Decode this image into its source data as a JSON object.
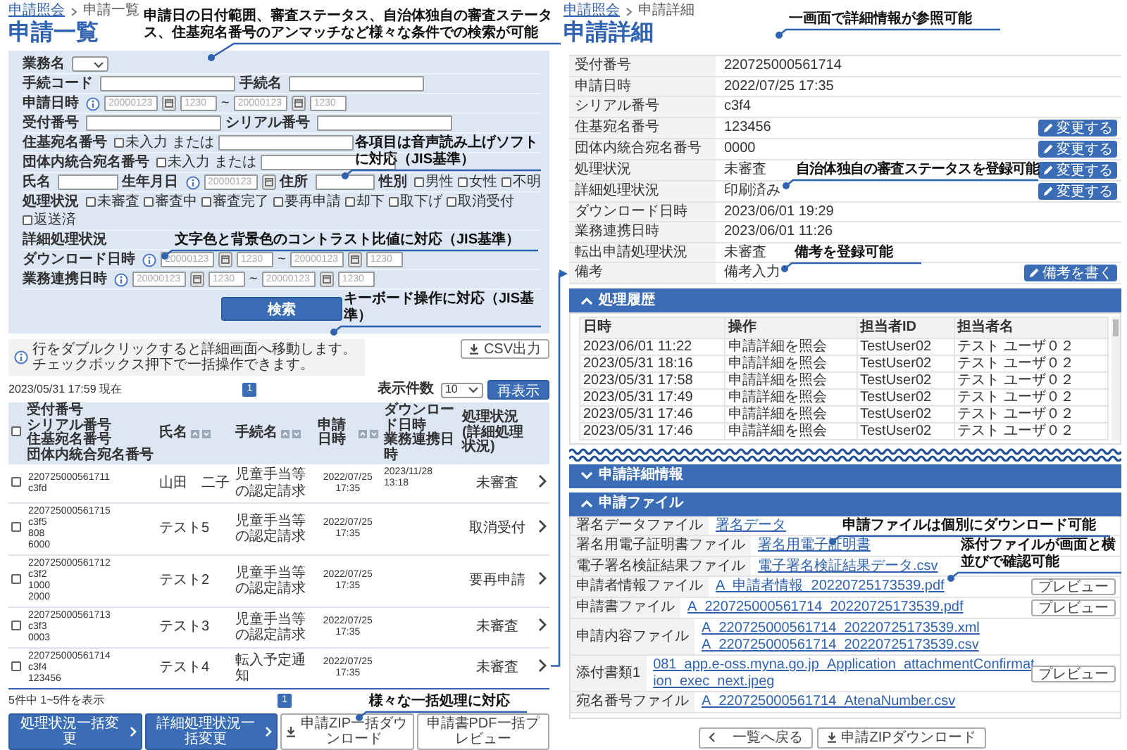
{
  "list_page": {
    "breadcrumb": [
      {
        "label": "申請照会",
        "link": true
      },
      {
        "label": "申請一覧",
        "link": false
      }
    ],
    "title": "申請一覧",
    "search_form": {
      "rows": [
        {
          "items": [
            {
              "kind": "label",
              "text": "業務名"
            },
            {
              "kind": "select"
            }
          ]
        },
        {
          "items": [
            {
              "kind": "label",
              "text": "手続コード"
            },
            {
              "kind": "input"
            },
            {
              "kind": "label",
              "text": "手続名"
            },
            {
              "kind": "input"
            }
          ]
        },
        {
          "items": [
            {
              "kind": "label",
              "text": "申請日時"
            },
            {
              "kind": "info"
            },
            {
              "kind": "date",
              "placeholder": "20000123"
            },
            {
              "kind": "calendar"
            },
            {
              "kind": "time",
              "placeholder": "1230"
            },
            {
              "kind": "text",
              "text": "~"
            },
            {
              "kind": "date",
              "placeholder": "20000123"
            },
            {
              "kind": "calendar"
            },
            {
              "kind": "time",
              "placeholder": "1230"
            }
          ]
        },
        {
          "items": [
            {
              "kind": "label",
              "text": "受付番号"
            },
            {
              "kind": "input"
            },
            {
              "kind": "label",
              "text": "シリアル番号"
            },
            {
              "kind": "input"
            }
          ]
        },
        {
          "items": [
            {
              "kind": "label",
              "text": "住基宛名番号"
            },
            {
              "kind": "checkbox",
              "label": "未入力",
              "checked": false
            },
            {
              "kind": "text",
              "text": "または"
            },
            {
              "kind": "input"
            }
          ]
        },
        {
          "items": [
            {
              "kind": "label",
              "text": "団体内統合宛名番号"
            },
            {
              "kind": "checkbox",
              "label": "未入力",
              "checked": false
            },
            {
              "kind": "text",
              "text": "または"
            },
            {
              "kind": "input"
            }
          ]
        },
        {
          "items": [
            {
              "kind": "label",
              "text": "氏名"
            },
            {
              "kind": "input"
            },
            {
              "kind": "label",
              "text": "生年月日"
            },
            {
              "kind": "info"
            },
            {
              "kind": "date",
              "placeholder": "20000123"
            },
            {
              "kind": "calendar"
            },
            {
              "kind": "label",
              "text": "住所"
            },
            {
              "kind": "input"
            },
            {
              "kind": "label",
              "text": "性別"
            },
            {
              "kind": "checkbox",
              "label": "男性",
              "checked": false
            },
            {
              "kind": "checkbox",
              "label": "女性",
              "checked": false
            },
            {
              "kind": "checkbox",
              "label": "不明",
              "checked": false
            }
          ]
        },
        {
          "items": [
            {
              "kind": "label",
              "text": "処理状況"
            },
            {
              "kind": "checkbox",
              "label": "未審査",
              "checked": false
            },
            {
              "kind": "checkbox",
              "label": "審査中",
              "checked": false
            },
            {
              "kind": "checkbox",
              "label": "審査完了",
              "checked": false
            },
            {
              "kind": "checkbox",
              "label": "要再申請",
              "checked": false
            },
            {
              "kind": "checkbox",
              "label": "却下",
              "checked": false
            },
            {
              "kind": "checkbox",
              "label": "取下げ",
              "checked": false
            },
            {
              "kind": "checkbox",
              "label": "取消受付",
              "checked": false
            },
            {
              "kind": "checkbox",
              "label": "返送済",
              "checked": false
            }
          ]
        },
        {
          "items": [
            {
              "kind": "label",
              "text": "詳細処理状況"
            }
          ]
        },
        {
          "items": [
            {
              "kind": "label",
              "text": "ダウンロード日時"
            },
            {
              "kind": "info"
            },
            {
              "kind": "date",
              "placeholder": "20000123"
            },
            {
              "kind": "calendar"
            },
            {
              "kind": "time",
              "placeholder": "1230"
            },
            {
              "kind": "text",
              "text": "~"
            },
            {
              "kind": "date",
              "placeholder": "20000123"
            },
            {
              "kind": "calendar"
            },
            {
              "kind": "time",
              "placeholder": "1230"
            }
          ]
        },
        {
          "items": [
            {
              "kind": "label",
              "text": "業務連携日時"
            },
            {
              "kind": "info"
            },
            {
              "kind": "date",
              "placeholder": "20000123"
            },
            {
              "kind": "calendar"
            },
            {
              "kind": "time",
              "placeholder": "1230"
            },
            {
              "kind": "text",
              "text": "~"
            },
            {
              "kind": "date",
              "placeholder": "20000123"
            },
            {
              "kind": "calendar"
            },
            {
              "kind": "time",
              "placeholder": "1230"
            }
          ]
        }
      ],
      "submit": "検索"
    },
    "csv_button": "CSV出力",
    "notice": [
      "行をダブルクリックすると詳細画面へ移動します。",
      "チェックボックス押下で一括操作できます。"
    ],
    "as_of": "2023/05/31 17:59 現在",
    "pages": [
      {
        "label": "1",
        "selected": true
      }
    ],
    "page_size_label": "表示件数",
    "page_size": "10",
    "refresh_button": "再表示",
    "table": {
      "columns": [
        {
          "kind": "checkbox",
          "checked": false
        },
        {
          "kind": "text",
          "lines": [
            "受付番号",
            "シリアル番号",
            "住基宛名番号",
            "団体内統合宛名番号"
          ],
          "sortable": false
        },
        {
          "kind": "text",
          "lines": [
            "氏名"
          ],
          "sortable": true
        },
        {
          "kind": "text",
          "lines": [
            "手続名"
          ],
          "sortable": true
        },
        {
          "kind": "text",
          "lines": [
            "申請日時"
          ],
          "sortable": true
        },
        {
          "kind": "text",
          "lines": [
            "ダウンロード日時",
            "業務連携日時"
          ],
          "sortable": false
        },
        {
          "kind": "text",
          "lines": [
            "処理状況",
            "(詳細処理状況)"
          ],
          "sortable": false
        }
      ],
      "rows": [
        {
          "checked": false,
          "ids": [
            "220725000561711",
            "c3fd"
          ],
          "name": "山田　二子",
          "procedure": "児童手当等の認定請求",
          "applied": [
            "2022/07/25",
            "17:35"
          ],
          "downloaded": "2023/11/28 13:18",
          "status": "未審査"
        },
        {
          "checked": false,
          "ids": [
            "220725000561715",
            "c3f5",
            "808",
            "6000"
          ],
          "name": "テスト5",
          "procedure": "児童手当等の認定請求",
          "applied": [
            "2022/07/25",
            "17:35"
          ],
          "status": "取消受付"
        },
        {
          "checked": false,
          "ids": [
            "220725000561712",
            "c3f2",
            "1000",
            "2000"
          ],
          "name": "テスト2",
          "procedure": "児童手当等の認定請求",
          "applied": [
            "2022/07/25",
            "17:35"
          ],
          "status": "要再申請"
        },
        {
          "checked": false,
          "ids": [
            "220725000561713",
            "c3f3",
            "0003"
          ],
          "name": "テスト3",
          "procedure": "児童手当等の認定請求",
          "applied": [
            "2022/07/25",
            "17:35"
          ],
          "status": "未審査"
        },
        {
          "checked": false,
          "ids": [
            "220725000561714",
            "c3f4",
            "123456"
          ],
          "name": "テスト4",
          "procedure": "転入予定通知",
          "applied": [
            "2022/07/25",
            "17:35"
          ],
          "status": "未審査"
        }
      ]
    },
    "summary": "5件中 1~5件を表示",
    "footer_pages": [
      {
        "label": "1",
        "selected": true
      }
    ],
    "actions": [
      {
        "label": "処理状況一括変更",
        "kind": "primary"
      },
      {
        "label": "詳細処理状況一括変更",
        "kind": "primary"
      },
      {
        "label": "申請ZIP一括ダウンロード",
        "kind": "download"
      },
      {
        "label": "申請書PDF一括プレビュー",
        "kind": "plain"
      }
    ]
  },
  "detail_page": {
    "breadcrumb": [
      {
        "label": "申請照会",
        "link": true
      },
      {
        "label": "申請詳細",
        "link": false
      }
    ],
    "title": "申請詳細",
    "fields": [
      {
        "label": "受付番号",
        "value": "220725000561714"
      },
      {
        "label": "申請日時",
        "value": "2022/07/25 17:35"
      },
      {
        "label": "シリアル番号",
        "value": "c3f4"
      },
      {
        "label": "住基宛名番号",
        "value": "123456",
        "action": "変更する"
      },
      {
        "label": "団体内統合宛名番号",
        "value": "0000",
        "action": "変更する"
      },
      {
        "label": "処理状況",
        "value": "未審査",
        "action": "変更する"
      },
      {
        "label": "詳細処理状況",
        "value": "印刷済み",
        "action": "変更する"
      },
      {
        "label": "ダウンロード日時",
        "value": "2023/06/01 19:29"
      },
      {
        "label": "業務連携日時",
        "value": "2023/06/01 11:26"
      },
      {
        "label": "転出申請処理状況",
        "value": "未審査"
      },
      {
        "label": "備考",
        "value": "備考入力",
        "action": "備考を書く"
      }
    ],
    "sections": [
      {
        "kind": "history",
        "title": "処理履歴",
        "expanded": true,
        "cut_below": true,
        "columns": [
          "日時",
          "操作",
          "担当者ID",
          "担当者名"
        ],
        "rows": [
          [
            "2023/06/01 11:22",
            "申請詳細を照会",
            "TestUser02",
            "テスト ユーザ０２"
          ],
          [
            "2023/05/31 18:16",
            "申請詳細を照会",
            "TestUser02",
            "テスト ユーザ０２"
          ],
          [
            "2023/05/31 17:58",
            "申請詳細を照会",
            "TestUser02",
            "テスト ユーザ０２"
          ],
          [
            "2023/05/31 17:49",
            "申請詳細を照会",
            "TestUser02",
            "テスト ユーザ０２"
          ],
          [
            "2023/05/31 17:46",
            "申請詳細を照会",
            "TestUser02",
            "テスト ユーザ０２"
          ],
          [
            "2023/05/31 17:46",
            "申請詳細を照会",
            "TestUser02",
            "テスト ユーザ０２"
          ]
        ]
      },
      {
        "kind": "empty",
        "title": "申請詳細情報",
        "expanded": false
      },
      {
        "kind": "files",
        "title": "申請ファイル",
        "expanded": true,
        "rows": [
          {
            "label": "署名データファイル",
            "links": [
              "署名データ"
            ]
          },
          {
            "label": "署名用電子証明書ファイル",
            "links": [
              "署名用電子証明書"
            ]
          },
          {
            "label": "電子署名検証結果ファイル",
            "links": [
              "電子署名検証結果データ.csv"
            ]
          },
          {
            "label": "申請者情報ファイル",
            "links": [
              "A_申請者情報_20220725173539.pdf"
            ],
            "preview": "プレビュー"
          },
          {
            "label": "申請書ファイル",
            "links": [
              "A_220725000561714_20220725173539.pdf"
            ],
            "preview": "プレビュー"
          },
          {
            "label": "申請内容ファイル",
            "links": [
              "A_220725000561714_20220725173539.xml",
              "A_220725000561714_20220725173539.csv"
            ]
          },
          {
            "label": "添付書類1",
            "links": [
              "081_app.e-oss.myna.go.jp_Application_attachmentConfirmation_exec_next.jpeg"
            ],
            "preview": "プレビュー"
          },
          {
            "label": "宛名番号ファイル",
            "links": [
              "A_220725000561714_AtenaNumber.csv"
            ]
          }
        ]
      }
    ],
    "buttons": [
      {
        "label": "一覧へ戻る",
        "kind": "back"
      },
      {
        "label": "申請ZIPダウンロード",
        "kind": "download"
      }
    ]
  },
  "callouts": [
    {
      "text": "申請日の日付範囲、審査ステータス、自治体独自の審査ステータス、住基宛名番号のアンマッチなど様々な条件での検索が可能"
    },
    {
      "text": "各項目は音声読み上げソフトに対応（JIS基準）"
    },
    {
      "text": "文字色と背景色のコントラスト比値に対応（JIS基準）"
    },
    {
      "text": "キーボード操作に対応（JIS基準）"
    },
    {
      "text": "様々な一括処理に対応"
    },
    {
      "text": "一画面で詳細情報が参照可能"
    },
    {
      "text": "自治体独自の審査ステータスを登録可能"
    },
    {
      "text": "備考を登録可能"
    },
    {
      "text": "申請ファイルは個別にダウンロード可能"
    },
    {
      "text": "添付ファイルが画面と横並びで確認可能"
    }
  ]
}
